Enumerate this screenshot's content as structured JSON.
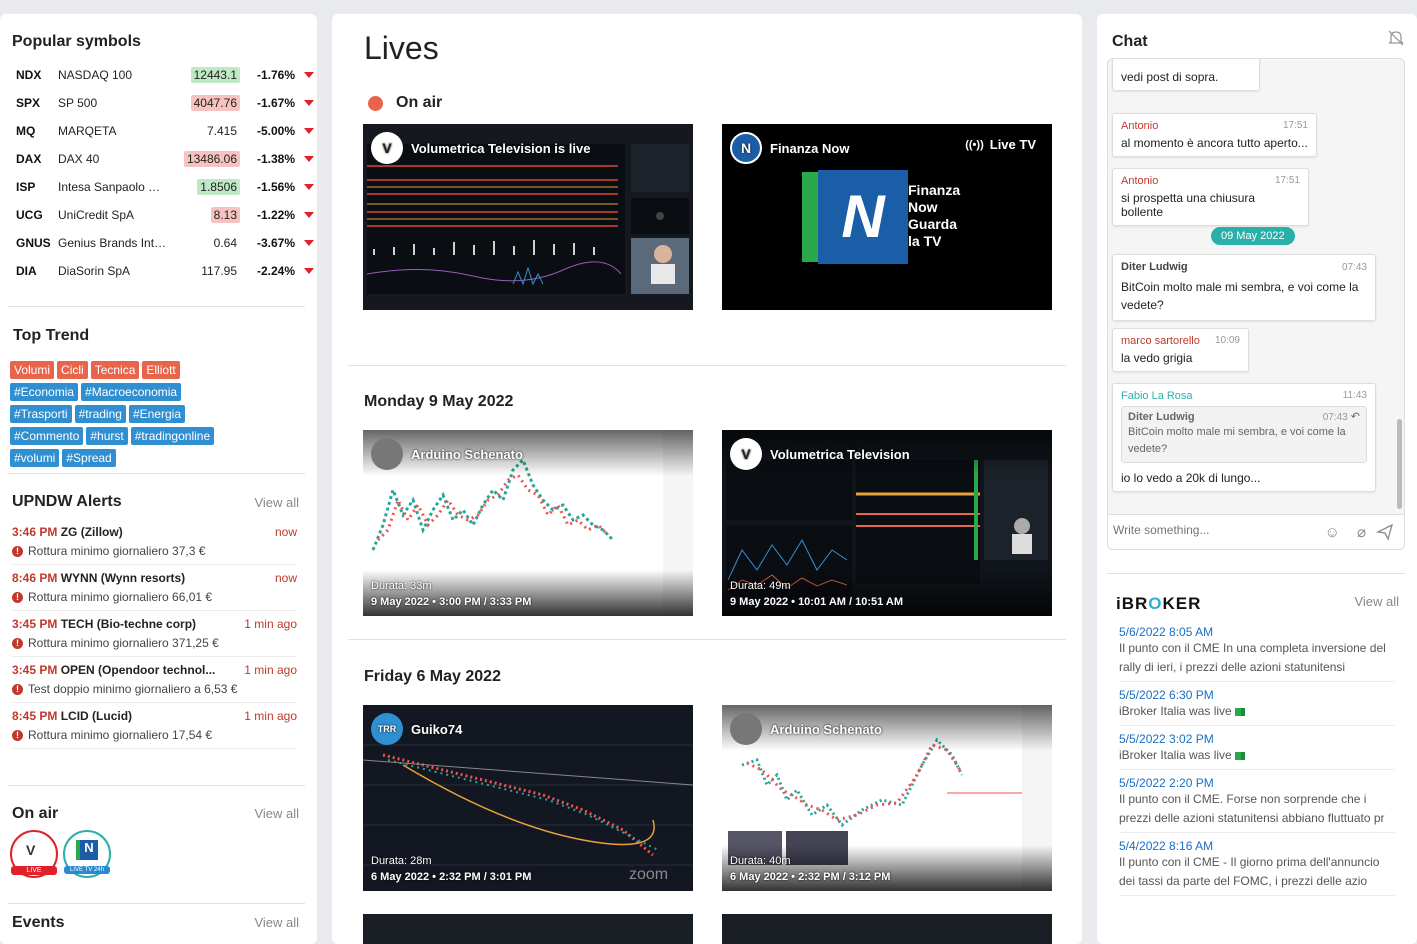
{
  "popular": {
    "title": "Popular symbols",
    "rows": [
      {
        "code": "NDX",
        "name": "NASDAQ 100",
        "price": "12443.1",
        "pc": "#bfe8c5",
        "chg": "-1.76%"
      },
      {
        "code": "SPX",
        "name": "SP 500",
        "price": "4047.76",
        "pc": "#f6c3c0",
        "chg": "-1.67%"
      },
      {
        "code": "MQ",
        "name": "MARQETA",
        "price": "7.415",
        "pc": "",
        "chg": "-5.00%"
      },
      {
        "code": "DAX",
        "name": "DAX 40",
        "price": "13486.06",
        "pc": "#f6c3c0",
        "chg": "-1.38%"
      },
      {
        "code": "ISP",
        "name": "Intesa Sanpaolo SpA",
        "price": "1.8506",
        "pc": "#bfe8c5",
        "chg": "-1.56%"
      },
      {
        "code": "UCG",
        "name": "UniCredit SpA",
        "price": "8.13",
        "pc": "#f6c3c0",
        "chg": "-1.22%"
      },
      {
        "code": "GNUS",
        "name": "Genius Brands Internatio...",
        "price": "0.64",
        "pc": "",
        "chg": "-3.67%"
      },
      {
        "code": "DIA",
        "name": "DiaSorin SpA",
        "price": "117.95",
        "pc": "",
        "chg": "-2.24%"
      }
    ]
  },
  "trend": {
    "title": "Top Trend",
    "tags": [
      {
        "label": "Volumi",
        "kind": "o"
      },
      {
        "label": "Cicli",
        "kind": "o"
      },
      {
        "label": "Tecnica",
        "kind": "o"
      },
      {
        "label": "Elliott",
        "kind": "o"
      },
      {
        "label": "#Economia",
        "kind": "b"
      },
      {
        "label": "#Macroeconomia",
        "kind": "b"
      },
      {
        "label": "#Trasporti",
        "kind": "b"
      },
      {
        "label": "#trading",
        "kind": "b"
      },
      {
        "label": "#Energia",
        "kind": "b"
      },
      {
        "label": "#Commento",
        "kind": "b"
      },
      {
        "label": "#hurst",
        "kind": "b"
      },
      {
        "label": "#tradingonline",
        "kind": "b"
      },
      {
        "label": "#volumi",
        "kind": "b"
      },
      {
        "label": "#Spread",
        "kind": "b"
      }
    ]
  },
  "alerts": {
    "title": "UPNDW Alerts",
    "view_all": "View all",
    "items": [
      {
        "time": "3:46 PM",
        "sym": "ZG (Zillow)",
        "ago": "now",
        "text": "Rottura minimo giornaliero 37,3 €"
      },
      {
        "time": "8:46 PM",
        "sym": "WYNN (Wynn resorts)",
        "ago": "now",
        "text": "Rottura minimo giornaliero 66,01 €"
      },
      {
        "time": "3:45 PM",
        "sym": "TECH (Bio-techne corp)",
        "ago": "1 min ago",
        "text": "Rottura minimo giornaliero 371,25 €"
      },
      {
        "time": "3:45 PM",
        "sym": "OPEN (Opendoor technol...",
        "ago": "1 min ago",
        "text": "Test doppio minimo giornaliero a 6,53 €"
      },
      {
        "time": "8:45 PM",
        "sym": "LCID (Lucid)",
        "ago": "1 min ago",
        "text": "Rottura minimo giornaliero 17,54 €"
      }
    ]
  },
  "onair_left": {
    "title": "On air",
    "view_all": "View all",
    "badge1": "LIVE",
    "badge2": "LIVE TV 24h"
  },
  "events": {
    "title": "Events",
    "view_all": "View all"
  },
  "lives": {
    "title": "Lives",
    "on_air": "On air",
    "live_cards": [
      {
        "title": "Volumetrica Television is live",
        "avatar": "V"
      },
      {
        "title": "Finanza Now",
        "avatar": "N",
        "tag": "Live TV",
        "logo1": "Finanza",
        "logo2": "Now",
        "logo3": "Guarda",
        "logo4": "la TV"
      }
    ],
    "days": [
      {
        "label": "Monday 9 May 2022",
        "cards": [
          {
            "title": "Arduino Schenato",
            "dur": "Durata: 33m",
            "when": "9 May 2022 • 3:00 PM / 3:33 PM"
          },
          {
            "title": "Volumetrica Television",
            "dur": "Durata: 49m",
            "when": "9 May 2022 • 10:01 AM / 10:51 AM"
          }
        ]
      },
      {
        "label": "Friday 6 May 2022",
        "cards": [
          {
            "title": "Guiko74",
            "dur": "Durata: 28m",
            "when": "6 May 2022 • 2:32 PM / 3:01 PM"
          },
          {
            "title": "Arduino Schenato",
            "dur": "Durata: 40m",
            "when": "6 May 2022 • 2:32 PM / 3:12 PM"
          }
        ]
      }
    ]
  },
  "chat": {
    "title": "Chat",
    "placeholder": "Write something...",
    "date_pill": "09 May 2022",
    "msgs": [
      {
        "text": "vedi post di sopra."
      },
      {
        "user": "Antonio",
        "time": "17:51",
        "text": "al momento è ancora tutto aperto..."
      },
      {
        "user": "Antonio",
        "time": "17:51",
        "text": "si prospetta una chiusura bollente"
      },
      {
        "user": "Diter Ludwig",
        "time": "07:43",
        "text": "BitCoin molto male mi sembra, e voi come la vedete?"
      },
      {
        "user": "marco sartorello",
        "time": "10:09",
        "text": "la vedo grigia"
      },
      {
        "user": "Fabio La Rosa",
        "time": "11:43",
        "quote_user": "Diter Ludwig",
        "quote_time": "07:43",
        "quote_text": "BitCoin molto male mi sembra, e voi come la vedete?",
        "text": "io lo vedo a 20k di lungo..."
      }
    ]
  },
  "ibroker": {
    "title_a": "iBR",
    "title_b": "O",
    "title_c": "KER",
    "view_all": "View all",
    "items": [
      {
        "date": "5/6/2022 8:05 AM",
        "text": "Il punto con il CME In una completa inversione del rally di ieri, i prezzi delle azioni statunitensi"
      },
      {
        "date": "5/5/2022 6:30 PM",
        "text": "iBroker Italia was live"
      },
      {
        "date": "5/5/2022 3:02 PM",
        "text": "iBroker Italia was live"
      },
      {
        "date": "5/5/2022 2:20 PM",
        "text": "Il punto con il CME. Forse non sorprende che i prezzi delle azioni statunitensi abbiano fluttuato pr"
      },
      {
        "date": "5/4/2022 8:16 AM",
        "text": "Il punto con il CME - Il giorno prima dell'annuncio dei tassi da parte del FOMC, i prezzi delle azio"
      }
    ]
  }
}
